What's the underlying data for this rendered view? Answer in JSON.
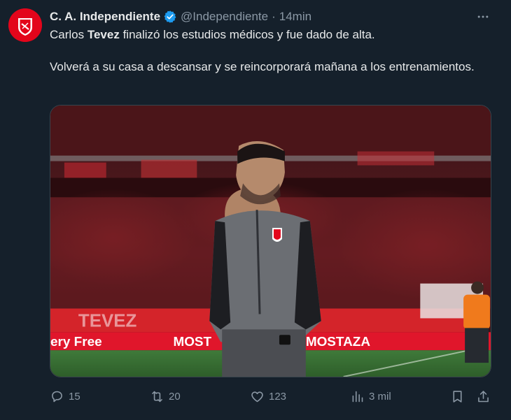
{
  "account": {
    "display_name": "C. A. Independiente",
    "handle": "@Independiente",
    "separator": "·",
    "time": "14min",
    "verified": true,
    "avatar_icon": "independiente-crest-icon"
  },
  "tweet": {
    "line1_prefix": "Carlos ",
    "line1_bold": "Tevez",
    "line1_suffix": " finalizó los estudios médicos y fue dado de alta.",
    "line2": "Volverá a su casa a descansar y se reincorporará mañana a los entrenamientos."
  },
  "media": {
    "banner_left": "ery Free",
    "banner_mid": "MOST",
    "banner_right": "MOSTAZA",
    "stands_text": "TEVEZ"
  },
  "actions": {
    "replies": "15",
    "retweets": "20",
    "likes": "123",
    "views": "3 mil"
  },
  "colors": {
    "background": "#15202b",
    "text": "#e7e9ea",
    "muted": "#8b98a5",
    "verified": "#1d9bf0",
    "club_red": "#e3051b"
  }
}
